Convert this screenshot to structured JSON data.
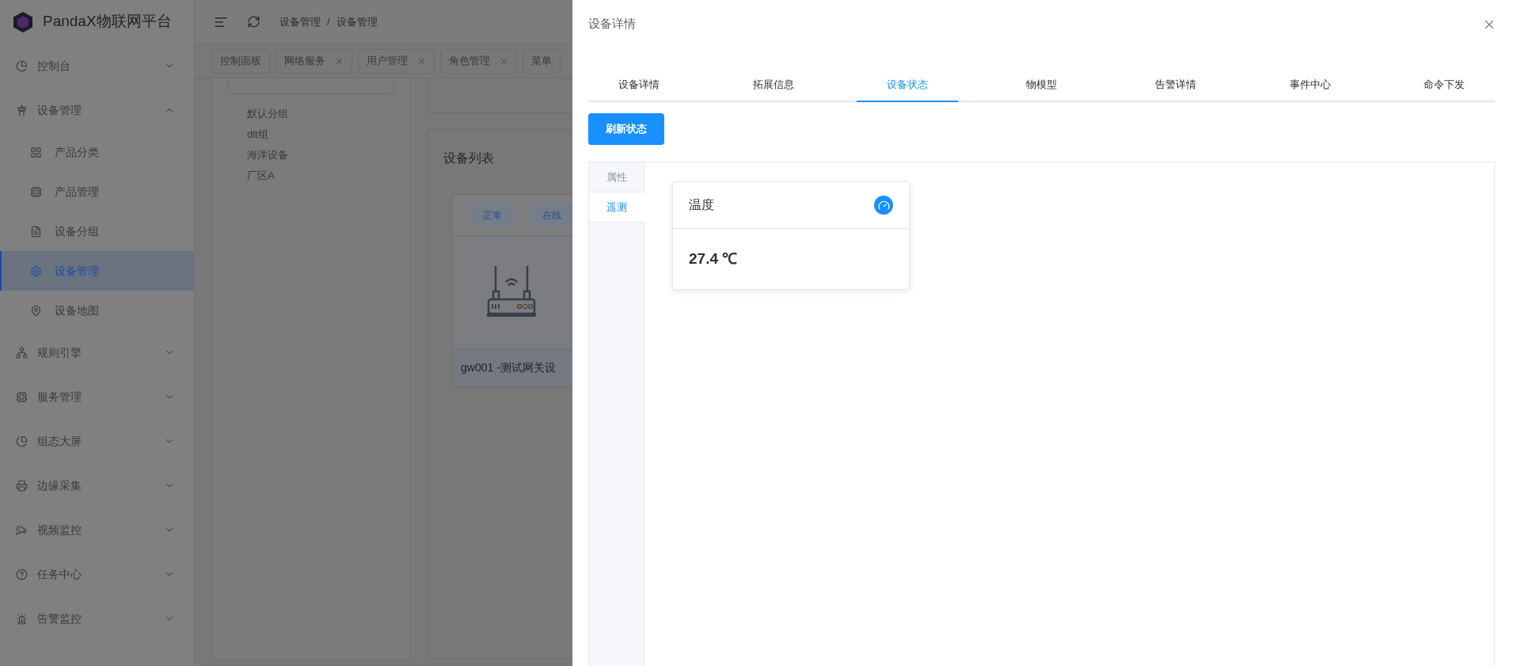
{
  "app": {
    "name": "PandaX物联网平台"
  },
  "sidebar": {
    "items": [
      {
        "label": "控制台",
        "expanded": false
      },
      {
        "label": "设备管理",
        "expanded": true,
        "children": [
          {
            "label": "产品分类",
            "selected": false
          },
          {
            "label": "产品管理",
            "selected": false
          },
          {
            "label": "设备分组",
            "selected": false
          },
          {
            "label": "设备管理",
            "selected": true
          },
          {
            "label": "设备地图",
            "selected": false
          }
        ]
      },
      {
        "label": "规则引擎",
        "expanded": false
      },
      {
        "label": "服务管理",
        "expanded": false
      },
      {
        "label": "组态大屏",
        "expanded": false
      },
      {
        "label": "边缘采集",
        "expanded": false
      },
      {
        "label": "视频监控",
        "expanded": false
      },
      {
        "label": "任务中心",
        "expanded": false
      },
      {
        "label": "告警监控",
        "expanded": false
      }
    ]
  },
  "header": {
    "breadcrumb": [
      "设备管理",
      "设备管理"
    ],
    "separator": "/"
  },
  "tags": [
    {
      "label": "控制面板",
      "closable": false
    },
    {
      "label": "网络服务",
      "closable": true
    },
    {
      "label": "用户管理",
      "closable": true
    },
    {
      "label": "角色管理",
      "closable": true
    },
    {
      "label": "菜单",
      "closable": false
    }
  ],
  "group_tree": [
    "默认分组",
    "dlt组",
    "海洋设备",
    "厂区A"
  ],
  "device_list": {
    "title": "设备列表",
    "devices": [
      {
        "tags": [
          "正常",
          "在线"
        ],
        "name": "gw001 -测试网关设"
      }
    ]
  },
  "drawer": {
    "title": "设备详情",
    "tabs": [
      {
        "label": "设备详情",
        "selected": false
      },
      {
        "label": "拓展信息",
        "selected": false
      },
      {
        "label": "设备状态",
        "selected": true
      },
      {
        "label": "物模型",
        "selected": false
      },
      {
        "label": "告警详情",
        "selected": false
      },
      {
        "label": "事件中心",
        "selected": false
      },
      {
        "label": "命令下发",
        "selected": false
      }
    ],
    "refresh_button": "刷新状态",
    "side_tabs": [
      {
        "label": "属性",
        "selected": false
      },
      {
        "label": "遥测",
        "selected": true
      }
    ],
    "cards": [
      {
        "name": "温度",
        "value": "27.4 ℃"
      }
    ]
  }
}
